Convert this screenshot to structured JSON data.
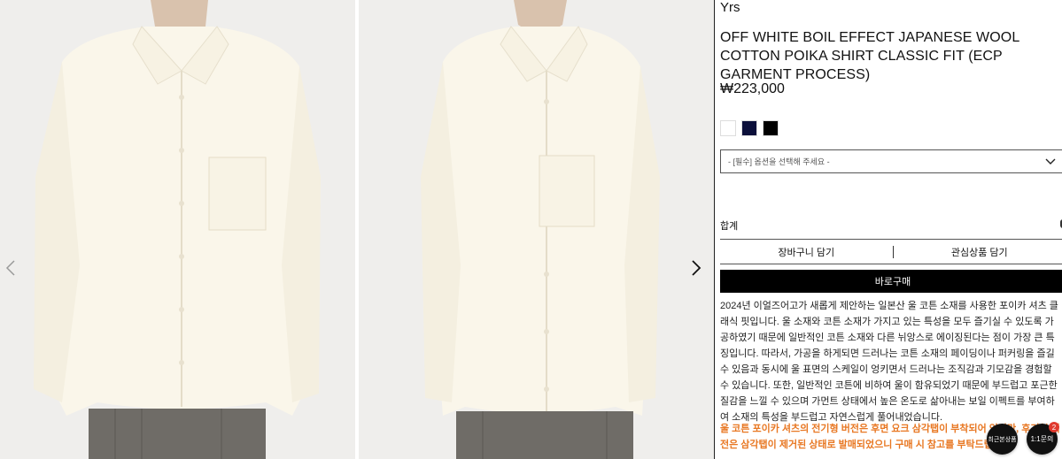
{
  "product": {
    "brand": "Yrs",
    "title": "OFF WHITE BOIL EFFECT JAPANESE WOOL COTTON POIKA SHIRT CLASSIC FIT (ECP GARMENT PROCESS)",
    "price": "₩223,000",
    "swatch_colors": [
      "#ffffff",
      "#0b0f3a",
      "#000000"
    ],
    "option_placeholder": "- [필수] 옵션을 선택해 주세요 -",
    "total_label": "합계",
    "cart_label": "장바구니 담기",
    "wish_label": "관심상품 담기",
    "buy_label": "바로구매",
    "description": "2024년 이얼즈어고가 새롭게 제안하는 일본산 울 코튼 소재를 사용한 포이카 셔츠 클래식 핏입니다. 울 소재와 코튼 소재가 가지고 있는 특성을 모두 즐기실 수 있도록 가공하였기 때문에 일반적인 코튼 소재와 다른 뉘앙스로 에이징된다는 점이 가장 큰 특징입니다. 따라서, 가공을 하게되면 드러나는 코튼 소재의 페이딩이나 퍼커링을 즐길 수 있음과 동시에 울 표면의 스케일이 엉키면서 드러나는 조직감과 기모감을 경험할 수 있습니다. 또한, 일반적인 코튼에 비하여 울이 함유되었기 때문에 부드럽고 포근한 질감을 느낄 수 있으며 가먼트 상태에서 높은 온도로 삶아내는 보일 이펙트를 부여하여 소재의 특성을 부드럽고 자연스럽게 풀어내었습니다.",
    "notice": "울 코튼 포이카 셔츠의 전기형 버전은 후면 요크 삼각탭이 부착되어 있지만, 후기형 버전은 삼각탭이 제거된 상태로 발매되었으니 구매 시 참고를 부탁드립니다."
  },
  "floating": {
    "recent_label": "최근본상품",
    "chat_label": "1:1문의",
    "chat_badge": "2"
  },
  "icons": {
    "prev": "chevron-left-icon",
    "next": "chevron-right-icon",
    "select": "chevron-down-icon"
  }
}
